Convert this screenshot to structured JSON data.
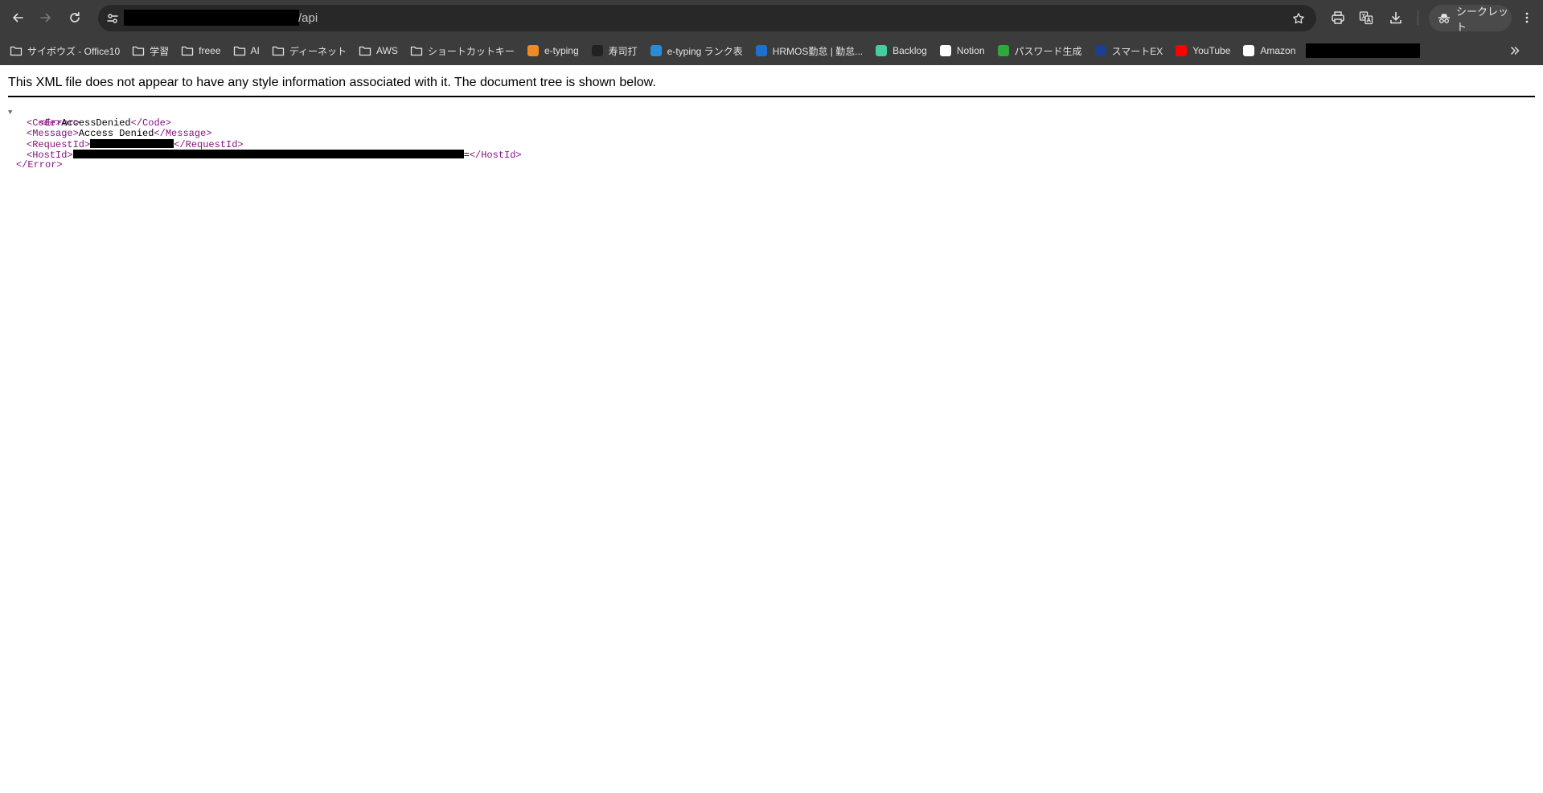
{
  "browser": {
    "url_suffix": "/api",
    "incognito_label": "シークレット"
  },
  "icons": {
    "back": "arrow-left-icon",
    "forward": "arrow-right-icon",
    "reload": "reload-icon",
    "site_info": "tune-icon",
    "bookmark_star": "star-icon",
    "print": "printer-icon",
    "translate": "translate-icon",
    "download": "download-icon",
    "incognito": "incognito-icon",
    "menu": "kebab-menu-icon",
    "bookmarks_overflow": "double-chevron-right-icon"
  },
  "bookmarks": [
    {
      "label": "サイボウズ - Office10",
      "type": "folder"
    },
    {
      "label": "学習",
      "type": "folder"
    },
    {
      "label": "freee",
      "type": "folder"
    },
    {
      "label": "AI",
      "type": "folder"
    },
    {
      "label": "ディーネット",
      "type": "folder"
    },
    {
      "label": "AWS",
      "type": "folder"
    },
    {
      "label": "ショートカットキー",
      "type": "folder"
    },
    {
      "label": "e-typing",
      "type": "site",
      "favicon_color": "#f08a24"
    },
    {
      "label": "寿司打",
      "type": "site",
      "favicon_color": "#222222"
    },
    {
      "label": "e-typing ランク表",
      "type": "site",
      "favicon_color": "#2a8bd6"
    },
    {
      "label": "HRMOS勤怠 | 勤怠...",
      "type": "site",
      "favicon_color": "#1f6fd1"
    },
    {
      "label": "Backlog",
      "type": "site",
      "favicon_color": "#42ce9f"
    },
    {
      "label": "Notion",
      "type": "site",
      "favicon_color": "#ffffff"
    },
    {
      "label": "パスワード生成",
      "type": "site",
      "favicon_color": "#2eaa3c"
    },
    {
      "label": "スマートEX",
      "type": "site",
      "favicon_color": "#1d3f8f"
    },
    {
      "label": "YouTube",
      "type": "site",
      "favicon_color": "#ff0000"
    },
    {
      "label": "Amazon",
      "type": "site",
      "favicon_color": "#ffffff"
    }
  ],
  "page": {
    "notice": "This XML file does not appear to have any style information associated with it. The document tree is shown below.",
    "xml": {
      "toggle": "▼",
      "root_open": "<Error>",
      "code_open": "<Code>",
      "code_value": "AccessDenied",
      "code_close": "</Code>",
      "message_open": "<Message>",
      "message_value": "Access Denied",
      "message_close": "</Message>",
      "requestid_open": "<RequestId>",
      "requestid_close": "</RequestId>",
      "hostid_open": "<HostId>",
      "hostid_tail": "=",
      "hostid_close": "</HostId>",
      "root_close": "</Error>"
    }
  }
}
